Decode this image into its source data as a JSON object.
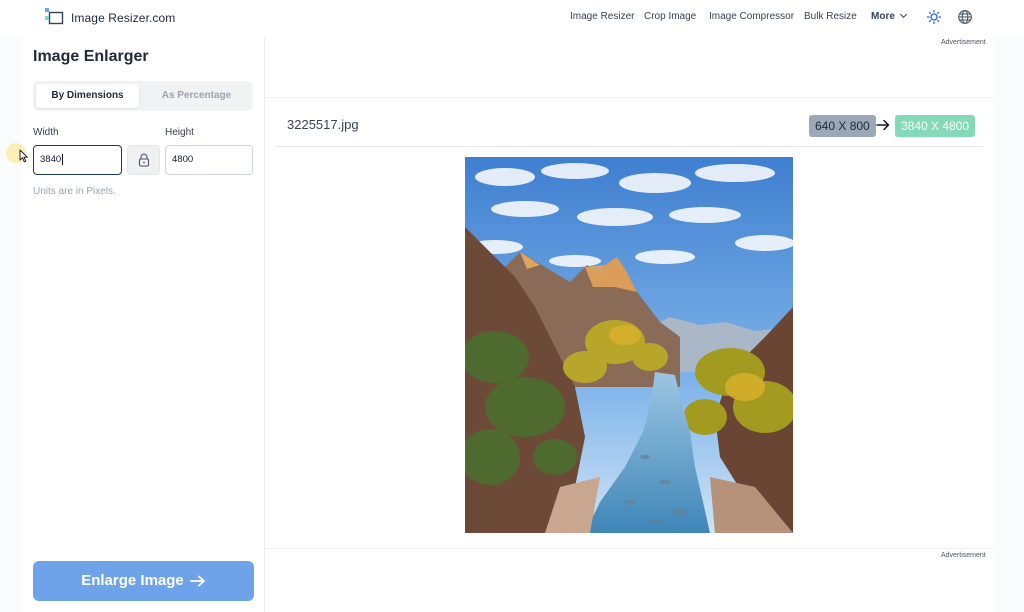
{
  "header": {
    "logo_text": "Image Resizer.com",
    "nav": [
      "Image Resizer",
      "Crop Image",
      "Image Compressor",
      "Bulk Resize"
    ],
    "more_label": "More",
    "icons": [
      "theme-sun-icon",
      "language-globe-icon"
    ]
  },
  "panel": {
    "title": "Image Enlarger",
    "tabs": [
      {
        "label": "By Dimensions",
        "active": true
      },
      {
        "label": "As Percentage",
        "active": false
      }
    ],
    "width_label": "Width",
    "height_label": "Height",
    "width_value": "3840",
    "height_value": "4800",
    "units_note": "Units are in Pixels.",
    "enlarge_button": "Enlarge Image"
  },
  "preview": {
    "ad_label_top": "Advertisement",
    "ad_label_bottom": "Advertisement",
    "filename": "3225517.jpg",
    "original_dimensions": "640 X 800",
    "new_dimensions": "3840 X 4800"
  },
  "colors": {
    "primary_button": "#6ea3ea",
    "old_dim_badge": "#9aa8b7",
    "new_dim_badge": "#84d9b7",
    "focus_border": "#1e3a5f"
  }
}
